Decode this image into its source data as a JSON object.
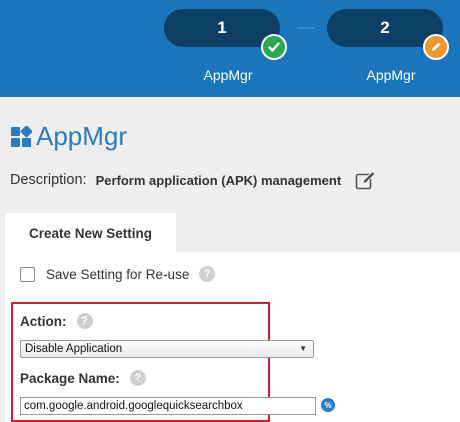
{
  "stepper": {
    "steps": [
      {
        "number": "1",
        "label": "AppMgr",
        "status": "complete",
        "status_icon": "check-icon"
      },
      {
        "number": "2",
        "label": "AppMgr",
        "status": "editing",
        "status_icon": "pencil-icon"
      }
    ],
    "colors": {
      "header": "#1b75bb",
      "pill": "#0d3f64",
      "complete": "#2aa84f",
      "editing": "#f0962e"
    }
  },
  "page": {
    "title": "AppMgr",
    "title_icon": "grid-icon",
    "description_label": "Description:",
    "description_value": "Perform application (APK) management",
    "edit_icon": "edit-icon"
  },
  "tabs": [
    {
      "label": "Create New Setting",
      "active": true
    }
  ],
  "form": {
    "save_setting_label": "Save Setting for Re-use",
    "save_setting_checked": false,
    "action_label": "Action:",
    "action_value": "Disable Application",
    "package_label": "Package Name:",
    "package_value": "com.google.android.googlequicksearchbox",
    "help_icon": "?",
    "variable_icon": "%"
  },
  "highlight_color": "#d42026"
}
